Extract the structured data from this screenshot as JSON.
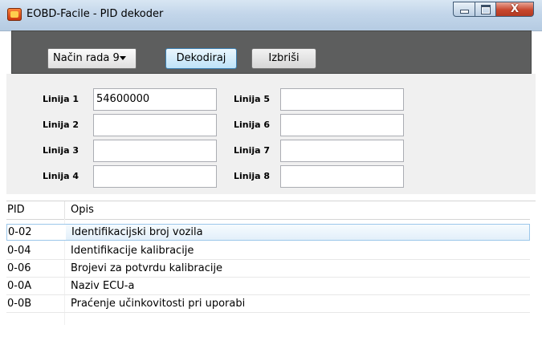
{
  "window": {
    "title": "EOBD-Facile - PID dekoder",
    "icon": "app-icon",
    "caption_buttons": [
      "minimize-icon",
      "maximize-icon",
      "close-icon"
    ],
    "close_glyph": "X"
  },
  "toolbar": {
    "mode_select": "Način rada 9",
    "decode_label": "Dekodiraj",
    "clear_label": "Izbriši"
  },
  "inputs": [
    {
      "label": "Linija 1",
      "value": "54600000"
    },
    {
      "label": "Linija 2",
      "value": ""
    },
    {
      "label": "Linija 3",
      "value": ""
    },
    {
      "label": "Linija 4",
      "value": ""
    },
    {
      "label": "Linija 5",
      "value": ""
    },
    {
      "label": "Linija 6",
      "value": ""
    },
    {
      "label": "Linija 7",
      "value": ""
    },
    {
      "label": "Linija 8",
      "value": ""
    }
  ],
  "table": {
    "columns": [
      "PID",
      "Opis"
    ],
    "rows": [
      {
        "pid": "0-02",
        "desc": "Identifikacijski broj vozila",
        "selected": true
      },
      {
        "pid": "0-04",
        "desc": "Identifikacije kalibracije"
      },
      {
        "pid": "0-06",
        "desc": "Brojevi za potvrdu kalibracije"
      },
      {
        "pid": "0-0A",
        "desc": "Naziv ECU-a"
      },
      {
        "pid": "0-0B",
        "desc": "Praćenje učinkovitosti pri uporabi"
      }
    ]
  },
  "colors": {
    "toolbar_bg": "#5d5e5e",
    "panel_bg": "#f0f0f0",
    "selection_border": "#9cc7ea",
    "close_button": "#c8472e"
  }
}
